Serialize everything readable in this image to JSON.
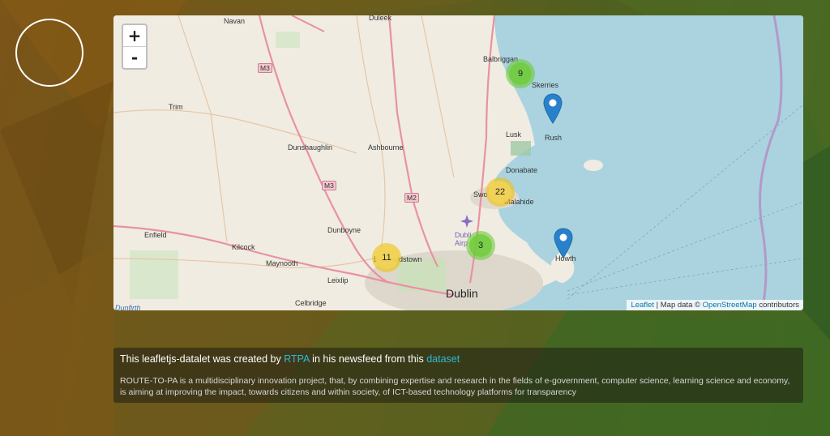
{
  "map": {
    "zoom_in_label": "+",
    "zoom_out_label": "-",
    "places": [
      {
        "id": "navan",
        "name": "Navan",
        "big": false
      },
      {
        "id": "duleek",
        "name": "Duleek",
        "big": false
      },
      {
        "id": "balbriggan",
        "name": "Balbriggan",
        "big": false
      },
      {
        "id": "skerries",
        "name": "Skerries",
        "big": false
      },
      {
        "id": "trim",
        "name": "Trim",
        "big": false
      },
      {
        "id": "lusk",
        "name": "Lusk",
        "big": false
      },
      {
        "id": "rush",
        "name": "Rush",
        "big": false
      },
      {
        "id": "dunshaughlin",
        "name": "Dunshaughlin",
        "big": false
      },
      {
        "id": "ashbourne",
        "name": "Ashbourne",
        "big": false
      },
      {
        "id": "donabate",
        "name": "Donabate",
        "big": false
      },
      {
        "id": "swords",
        "name": "Swo",
        "big": false
      },
      {
        "id": "malahide",
        "name": "Malahide",
        "big": false
      },
      {
        "id": "enfield",
        "name": "Enfield",
        "big": false
      },
      {
        "id": "kilcock",
        "name": "Kilcock",
        "big": false
      },
      {
        "id": "dunboyne",
        "name": "Dunboyne",
        "big": false
      },
      {
        "id": "dublin_airport",
        "name": "Dubli Airp",
        "big": false
      },
      {
        "id": "blanchardstown",
        "name": "B    nchardstown",
        "big": false
      },
      {
        "id": "howth",
        "name": "Howth",
        "big": false
      },
      {
        "id": "maynooth",
        "name": "Maynooth",
        "big": false
      },
      {
        "id": "leixlip",
        "name": "Leixlip",
        "big": false
      },
      {
        "id": "celbridge",
        "name": "Celbridge",
        "big": false
      },
      {
        "id": "dublin",
        "name": "Dublin",
        "big": true
      },
      {
        "id": "dunfirth",
        "name": "Dunfirth",
        "big": false
      }
    ],
    "road_shields": [
      {
        "id": "m3a",
        "label": "M3"
      },
      {
        "id": "m3b",
        "label": "M3"
      },
      {
        "id": "m2",
        "label": "M2"
      }
    ],
    "clusters": [
      {
        "id": "c9",
        "count": "9",
        "color": "green"
      },
      {
        "id": "c22",
        "count": "22",
        "color": "yellow"
      },
      {
        "id": "c3",
        "count": "3",
        "color": "green"
      },
      {
        "id": "c11",
        "count": "11",
        "color": "yellow"
      }
    ],
    "markers": [
      {
        "id": "m_rush",
        "color": "#2a81cb"
      },
      {
        "id": "m_howth",
        "color": "#2a81cb"
      }
    ],
    "attribution": {
      "leaflet": "Leaflet",
      "separator": " | Map data © ",
      "osm": "OpenStreetMap",
      "suffix": " contributors"
    }
  },
  "info": {
    "prefix": "This leafletjs-datalet was created by ",
    "author": "RTPA",
    "middle": " in his newsfeed from this ",
    "dataset": "dataset",
    "description": "ROUTE-TO-PA is a multidisciplinary innovation project, that, by combining expertise and research in the fields of e-government, computer science, learning science and economy, is aiming at improving the impact, towards citizens and within society, of ICT-based technology platforms for transparency"
  }
}
